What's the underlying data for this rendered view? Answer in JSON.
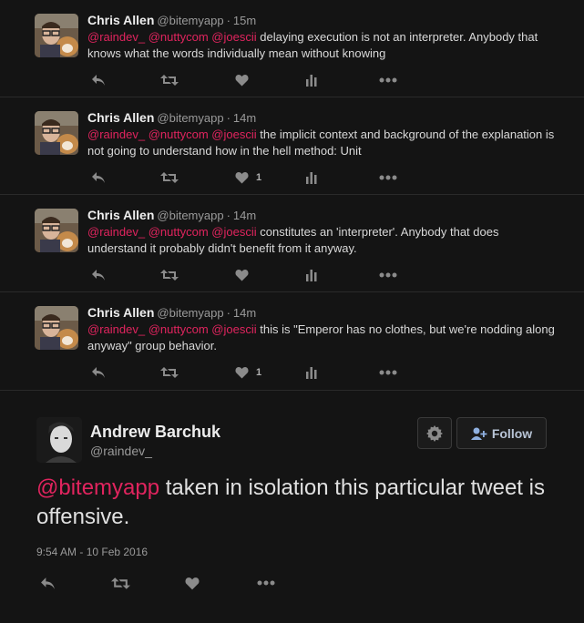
{
  "tweets": [
    {
      "name": "Chris Allen",
      "handle": "@bitemyapp",
      "time": "15m",
      "mentions": [
        "@raindev_",
        "@nuttycom",
        "@joescii"
      ],
      "text": "delaying execution is not an interpreter. Anybody that knows what the words individually mean without knowing",
      "like_count": ""
    },
    {
      "name": "Chris Allen",
      "handle": "@bitemyapp",
      "time": "14m",
      "mentions": [
        "@raindev_",
        "@nuttycom",
        "@joescii"
      ],
      "text": "the implicit context and background of the explanation is not going to understand how in the hell method: Unit",
      "like_count": "1"
    },
    {
      "name": "Chris Allen",
      "handle": "@bitemyapp",
      "time": "14m",
      "mentions": [
        "@raindev_",
        "@nuttycom",
        "@joescii"
      ],
      "text": "constitutes an 'interpreter'. Anybody that does understand it probably didn't benefit from it anyway.",
      "like_count": ""
    },
    {
      "name": "Chris Allen",
      "handle": "@bitemyapp",
      "time": "14m",
      "mentions": [
        "@raindev_",
        "@nuttycom",
        "@joescii"
      ],
      "text": "this is \"Emperor has no clothes, but we're nodding along anyway\" group behavior.",
      "like_count": "1"
    }
  ],
  "separator": "·",
  "focused": {
    "name": "Andrew Barchuk",
    "handle": "@raindev_",
    "mention": "@bitemyapp",
    "text": "taken in isolation this particular tweet is offensive.",
    "timestamp": "9:54 AM - 10 Feb 2016",
    "follow_label": "Follow"
  },
  "colors": {
    "mention": "#e0245e",
    "background": "#141414",
    "icon": "#8b8b8b"
  },
  "icons": [
    "reply-icon",
    "retweet-icon",
    "heart-icon",
    "analytics-icon",
    "more-icon",
    "gear-icon",
    "add-user-icon"
  ]
}
